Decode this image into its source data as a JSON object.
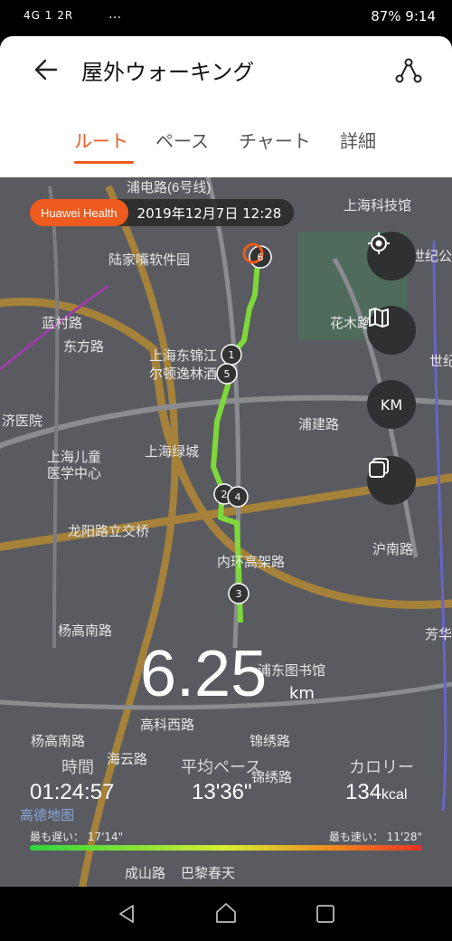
{
  "status": {
    "left": "4G  1  2R",
    "right": "87%  9:14"
  },
  "app": {
    "title": "屋外ウォーキング"
  },
  "tabs": [
    {
      "label": "ルート"
    },
    {
      "label": "ペース"
    },
    {
      "label": "チャート"
    },
    {
      "label": "詳細"
    }
  ],
  "map": {
    "badge": "Huawei Health",
    "datetime": "2019年12月7日 12:28",
    "labels": [
      "浦电路(6号线)",
      "上海科技馆",
      "陆家嘴软件园",
      "世纪公",
      "蓝村路",
      "花木路",
      "世纪",
      "上海东锦江",
      "尔顿逸林酒",
      "浦建路",
      "东方路",
      "济医院",
      "上海儿童",
      "医学中心",
      "上海绿城",
      "龙阳路立交桥",
      "内环高架路",
      "沪南路",
      "杨高南路",
      "芳华",
      "浦东图书馆",
      "高科西路",
      "锦绣路",
      "杨高南路",
      "海云路",
      "高德地图",
      "巴黎春天",
      "锦绣路",
      "成山路"
    ],
    "controls": [
      "KM"
    ]
  },
  "stats": {
    "distance": "6.25",
    "distance_unit": "km",
    "time_label": "時間",
    "time_value": "01:24:57",
    "pace_label": "平均ペース",
    "pace_value": "13'36\"",
    "cal_label": "カロリー",
    "cal_value": "134",
    "cal_unit": "kcal",
    "slowest": "最も遅い： 17'14\"",
    "fastest": "最も速い： 11'28\""
  }
}
